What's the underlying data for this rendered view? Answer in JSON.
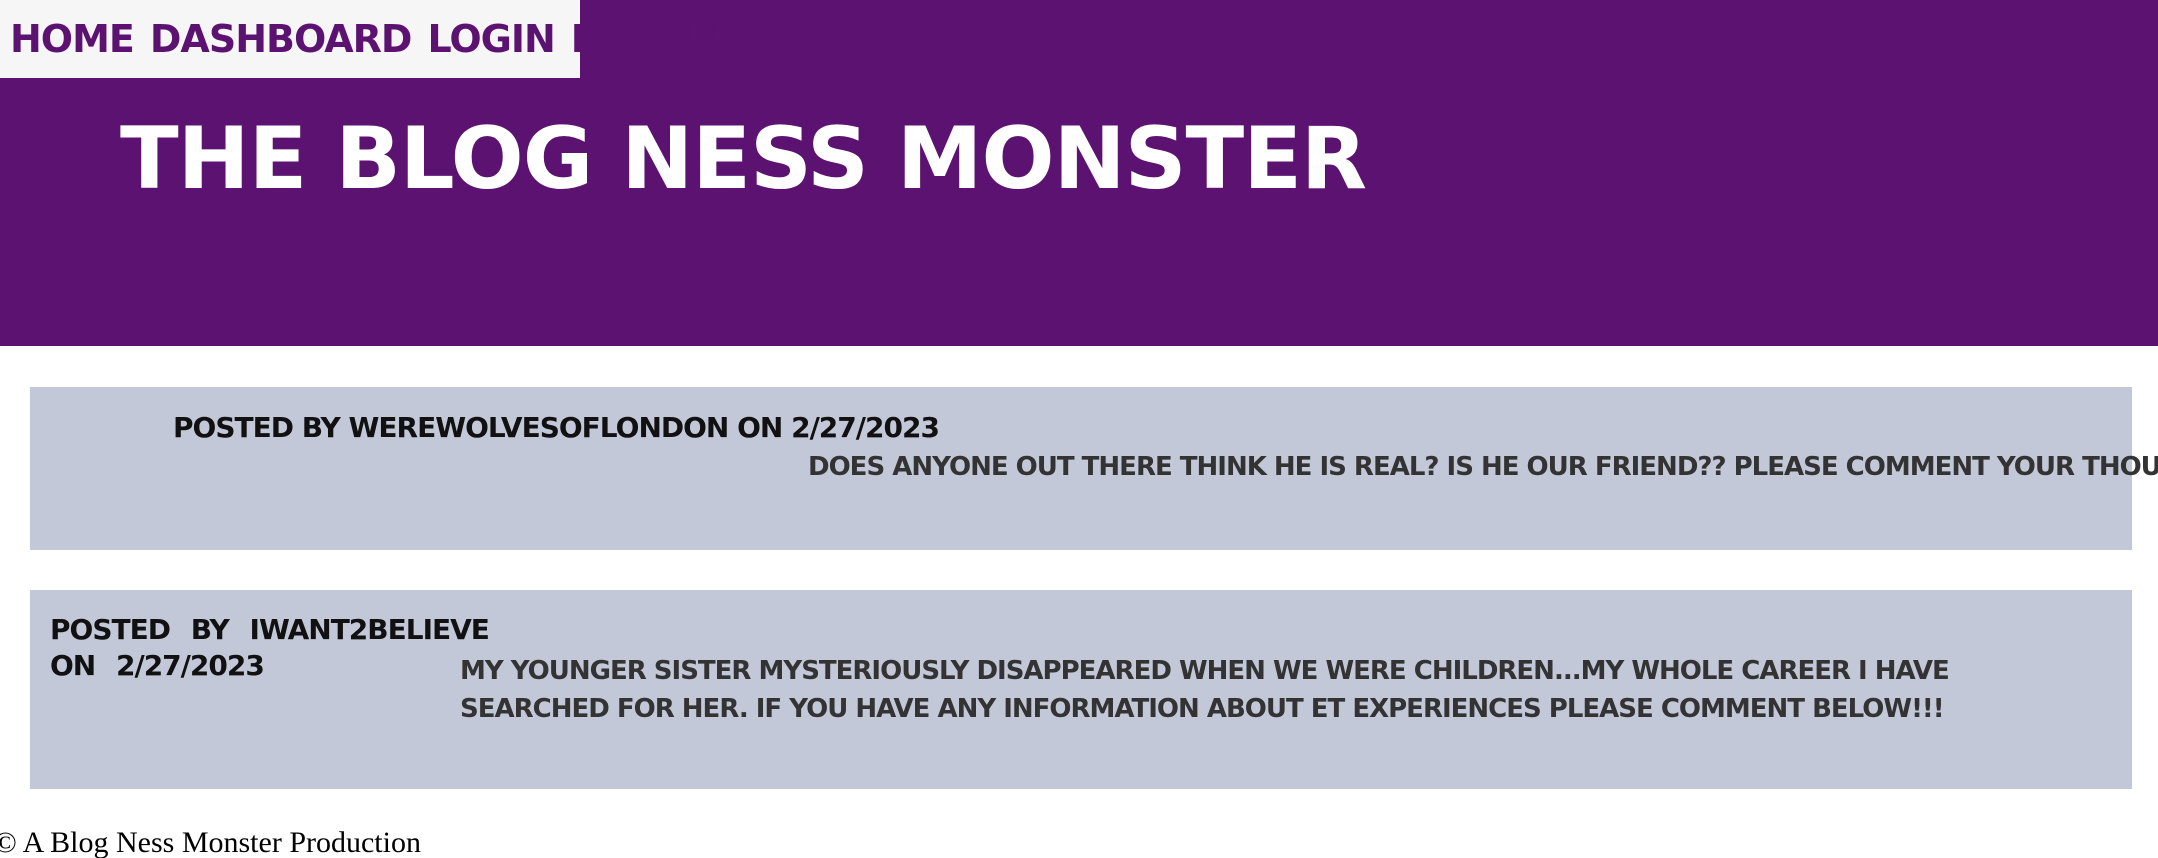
{
  "nav": {
    "items": [
      "HOME",
      "DASHBOARD",
      "LOGIN",
      "LOGOUT"
    ]
  },
  "header": {
    "title": "THE BLOG NESS MONSTER"
  },
  "posts": [
    {
      "meta_line1": "POSTED BY WEREWOLVESOFLONDON ON 2/27/2023",
      "content": "DOES ANYONE OUT THERE THINK HE IS REAL? IS HE OUR FRIEND?? PLEASE COMMENT YOUR THOUGHTS.."
    },
    {
      "meta_line1": "POSTED BY IWANT2BELIEVE",
      "meta_line2": "ON 2/27/2023",
      "content": "MY YOUNGER SISTER MYSTERIOUSLY DISAPPEARED WHEN WE WERE CHILDREN...MY WHOLE CAREER I HAVE SEARCHED FOR HER. IF YOU HAVE ANY INFORMATION ABOUT ET EXPERIENCES PLEASE COMMENT BELOW!!!"
    }
  ],
  "footer": {
    "text": "© A Blog Ness Monster Production"
  },
  "colors": {
    "header_bg": "#5b1271",
    "nav_bg": "#f7f6f6",
    "post_bg": "#c3c8d8"
  }
}
